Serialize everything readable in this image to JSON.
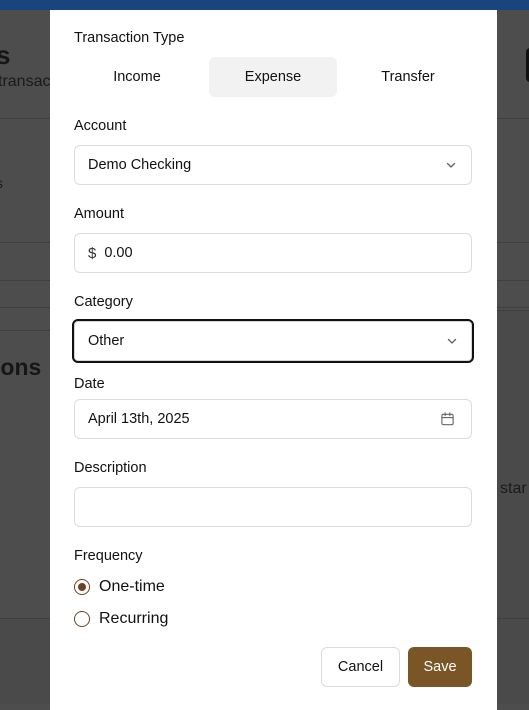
{
  "background": {
    "title_fragment": "s",
    "subtitle_fragment": "transac",
    "small_fragment": "s",
    "heading_fragment": "ions",
    "right_fragment": "star"
  },
  "modal": {
    "transaction_type": {
      "label": "Transaction Type",
      "options": [
        "Income",
        "Expense",
        "Transfer"
      ],
      "selected": "Expense"
    },
    "account": {
      "label": "Account",
      "value": "Demo Checking"
    },
    "amount": {
      "label": "Amount",
      "currency_symbol": "$",
      "value": "0.00"
    },
    "category": {
      "label": "Category",
      "value": "Other"
    },
    "date": {
      "label": "Date",
      "value": "April 13th, 2025"
    },
    "description": {
      "label": "Description",
      "value": ""
    },
    "frequency": {
      "label": "Frequency",
      "options": [
        "One-time",
        "Recurring"
      ],
      "selected": "One-time"
    },
    "actions": {
      "cancel": "Cancel",
      "save": "Save"
    }
  },
  "colors": {
    "accent": "#7a5525",
    "radio": "#6b4423",
    "topbar": "#17457c",
    "overlay": "#4d4d4d"
  },
  "icons": {
    "select": "chevron-down-icon",
    "date": "calendar-icon"
  }
}
